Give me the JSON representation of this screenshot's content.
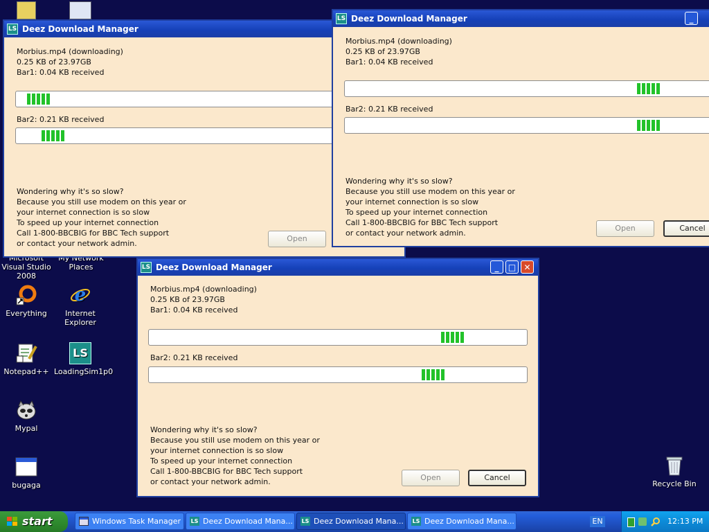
{
  "desktop": {
    "icons": [
      {
        "label": "Microsoft Visual Studio 2008"
      },
      {
        "label": "My Network Places"
      },
      {
        "label": "Everything"
      },
      {
        "label": "Internet Explorer"
      },
      {
        "label": "Notepad++"
      },
      {
        "label": "LoadingSim1p0"
      },
      {
        "label": "Mypal"
      },
      {
        "label": "bugaga"
      },
      {
        "label": "Recycle Bin"
      }
    ]
  },
  "window": {
    "title": "Deez Download Manager",
    "app_icon_text": "LS",
    "file_status": "Morbius.mp4 (downloading)",
    "size_status": "0.25 KB of 23.97GB",
    "bar1_label": "Bar1: 0.04 KB received",
    "bar2_label": "Bar2: 0.21 KB received",
    "message": [
      "Wondering why it's so slow?",
      "Because you still use modem on this year or",
      "your internet connection is so slow",
      "To speed up your internet connection",
      "Call 1-800-BBCBIG for BBC Tech support",
      "or contact your network admin."
    ],
    "open_label": "Open",
    "cancel_label": "Cancel",
    "minimize_glyph": "_",
    "maximize_glyph": "□",
    "close_glyph": "✕"
  },
  "taskbar": {
    "start_label": "start",
    "tasks": [
      {
        "label": "Windows Task Manager"
      },
      {
        "label": "Deez Download Mana..."
      },
      {
        "label": "Deez Download Mana..."
      },
      {
        "label": "Deez Download Mana..."
      }
    ],
    "language": "EN",
    "clock": "12:13 PM"
  },
  "colors": {
    "desktop": "#0c0c4a",
    "window_bg": "#fbe8cc",
    "progress_fill": "#22c22a",
    "titlebar": "#1641b8"
  }
}
